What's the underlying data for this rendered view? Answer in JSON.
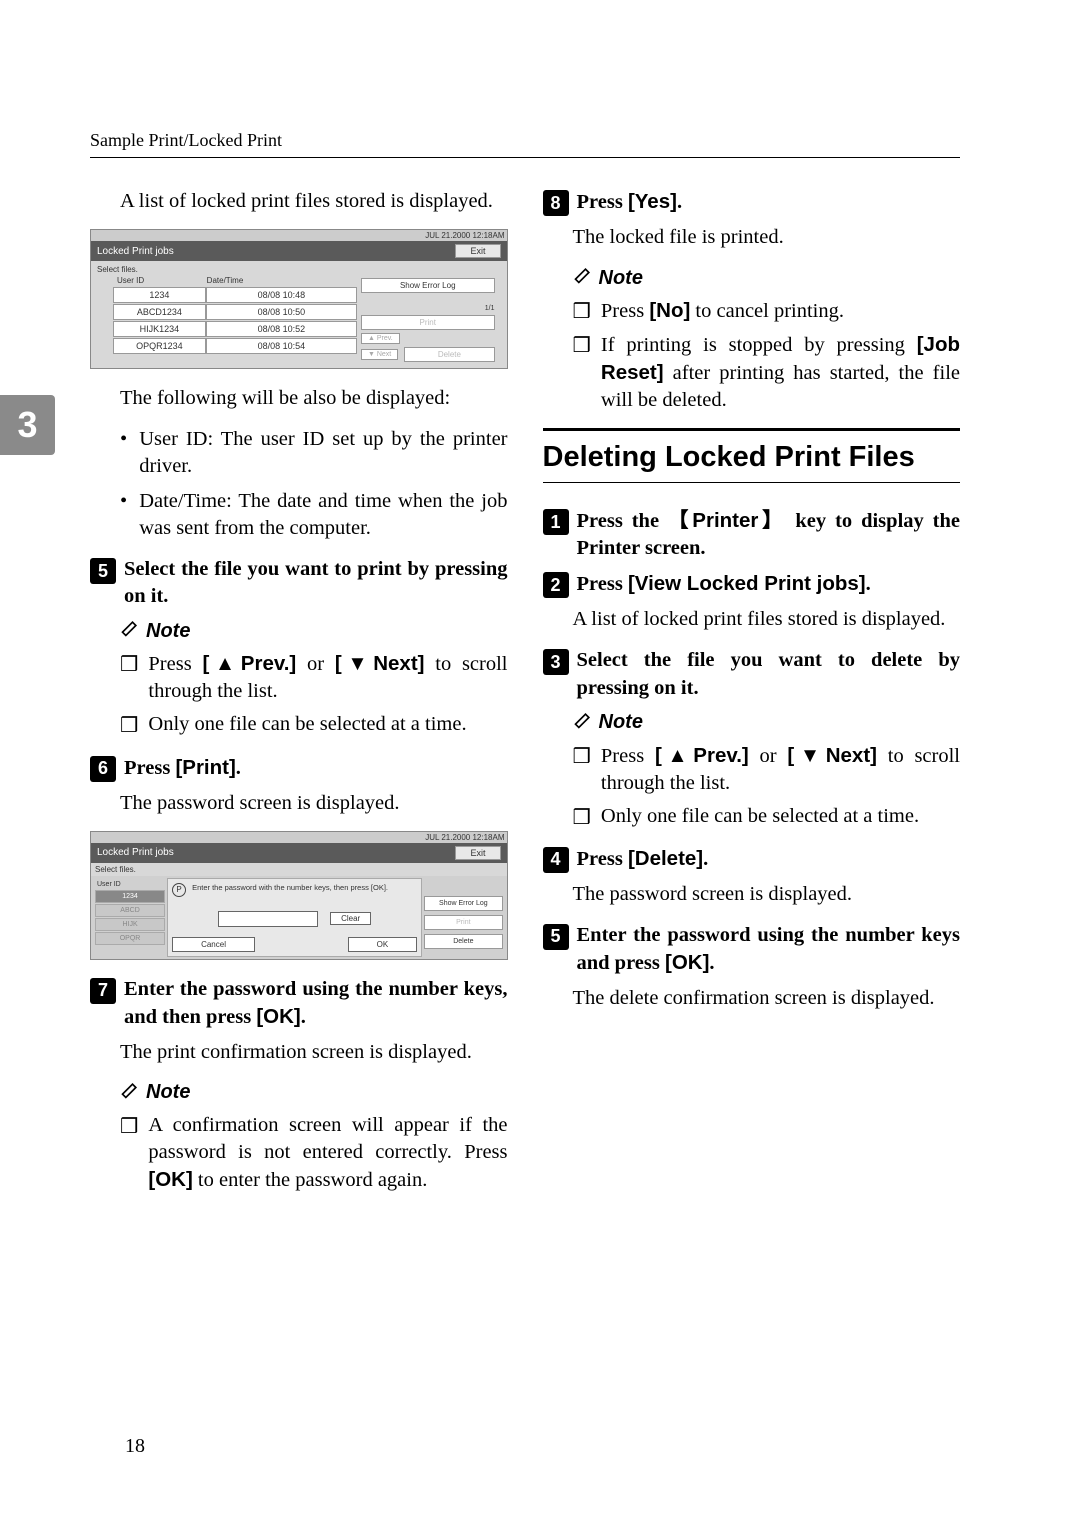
{
  "header": "Sample Print/Locked Print",
  "section_number": "3",
  "page_number": "18",
  "col1": {
    "p1": "A list of locked print files stored is displayed.",
    "screenshot1": {
      "date_header": "JUL    21.2000 12:18AM",
      "title": "Locked Print jobs",
      "exit": "Exit",
      "select_files": "Select files.",
      "th_user": "User ID",
      "th_date": "Date/Time",
      "rows": [
        {
          "user": "1234",
          "dt": "08/08  10:48"
        },
        {
          "user": "ABCD1234",
          "dt": "08/08  10:50"
        },
        {
          "user": "HIJK1234",
          "dt": "08/08  10:52"
        },
        {
          "user": "OPQR1234",
          "dt": "08/08  10:54"
        }
      ],
      "show_error": "Show Error Log",
      "print_btn": "Print",
      "delete_btn": "Delete",
      "prev": "▲ Prev.",
      "next": "▼ Next",
      "page": "1/1"
    },
    "p2": "The following will be also be displayed:",
    "bullets": {
      "b1": "User ID: The user ID set up by the printer driver.",
      "b2": "Date/Time: The date and time when the job was sent from the computer."
    },
    "step5": "Select the file you want to print by pressing on it.",
    "note": "Note",
    "note5_a_pre": "Press ",
    "note5_a_prev": "[▲Prev.]",
    "note5_a_mid": " or ",
    "note5_a_next": "[▼Next]",
    "note5_a_post": " to scroll through the list.",
    "note5_b": "Only one file can be selected at a time.",
    "step6_pre": "Press ",
    "step6_btn": "[Print]",
    "step6_post": ".",
    "p6": "The password screen is displayed.",
    "screenshot2": {
      "date_header": "JUL    21.2000 12:18AM",
      "title": "Locked Print jobs",
      "exit": "Exit",
      "select_files": "Select files.",
      "user_id": "User ID",
      "items": [
        "1234",
        "ABCD",
        "HIJK",
        "OPQR"
      ],
      "hint": "Enter the password with the number keys, then press [OK].",
      "clear": "Clear",
      "cancel": "Cancel",
      "ok": "OK",
      "show_error": "Show Error Log",
      "print_btn": "Print",
      "delete_btn": "Delete"
    },
    "step7_pre": "Enter the password using the number keys, and then press ",
    "step7_btn": "[OK]",
    "step7_post": ".",
    "p7": "The print confirmation screen is displayed.",
    "note7_pre": "A confirmation screen will appear if the password is not entered correctly. Press ",
    "note7_btn": "[OK]",
    "note7_post": " to enter the password again."
  },
  "col2": {
    "step8_pre": "Press ",
    "step8_btn": "[Yes]",
    "step8_post": ".",
    "p8": "The locked file is printed.",
    "note": "Note",
    "note8_a_pre": "Press ",
    "note8_a_btn": "[No]",
    "note8_a_post": " to cancel printing.",
    "note8_b_pre": "If printing is stopped by pressing ",
    "note8_b_btn": "[Job Reset]",
    "note8_b_post": " after printing has started, the file will be deleted.",
    "heading": "Deleting Locked Print Files",
    "step1_pre": "Press the ",
    "step1_key": "Printer",
    "step1_post": " key to display the Printer screen.",
    "step2_pre": "Press ",
    "step2_btn": "[View Locked Print jobs]",
    "step2_post": ".",
    "p2": "A list of locked print files stored is displayed.",
    "step3": "Select the file you want to delete by pressing on it.",
    "note3_a_pre": "Press ",
    "note3_a_prev": "[▲Prev.]",
    "note3_a_mid": " or ",
    "note3_a_next": "[▼Next]",
    "note3_a_post": " to scroll through the list.",
    "note3_b": "Only one file can be selected at a time.",
    "step4_pre": "Press ",
    "step4_btn": "[Delete]",
    "step4_post": ".",
    "p4": "The password screen is displayed.",
    "step5_pre": "Enter the password using the number keys and press ",
    "step5_btn": "[OK]",
    "step5_post": ".",
    "p5": "The delete confirmation screen is displayed."
  }
}
